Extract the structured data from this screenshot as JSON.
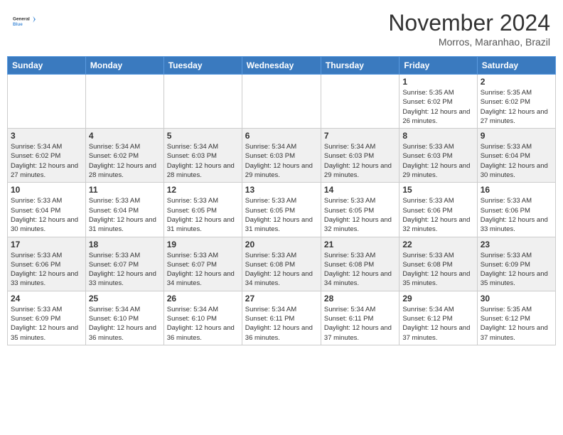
{
  "header": {
    "logo_line1": "General",
    "logo_line2": "Blue",
    "month": "November 2024",
    "location": "Morros, Maranhao, Brazil"
  },
  "weekdays": [
    "Sunday",
    "Monday",
    "Tuesday",
    "Wednesday",
    "Thursday",
    "Friday",
    "Saturday"
  ],
  "weeks": [
    [
      {
        "day": "",
        "info": ""
      },
      {
        "day": "",
        "info": ""
      },
      {
        "day": "",
        "info": ""
      },
      {
        "day": "",
        "info": ""
      },
      {
        "day": "",
        "info": ""
      },
      {
        "day": "1",
        "info": "Sunrise: 5:35 AM\nSunset: 6:02 PM\nDaylight: 12 hours and 26 minutes."
      },
      {
        "day": "2",
        "info": "Sunrise: 5:35 AM\nSunset: 6:02 PM\nDaylight: 12 hours and 27 minutes."
      }
    ],
    [
      {
        "day": "3",
        "info": "Sunrise: 5:34 AM\nSunset: 6:02 PM\nDaylight: 12 hours and 27 minutes."
      },
      {
        "day": "4",
        "info": "Sunrise: 5:34 AM\nSunset: 6:02 PM\nDaylight: 12 hours and 28 minutes."
      },
      {
        "day": "5",
        "info": "Sunrise: 5:34 AM\nSunset: 6:03 PM\nDaylight: 12 hours and 28 minutes."
      },
      {
        "day": "6",
        "info": "Sunrise: 5:34 AM\nSunset: 6:03 PM\nDaylight: 12 hours and 29 minutes."
      },
      {
        "day": "7",
        "info": "Sunrise: 5:34 AM\nSunset: 6:03 PM\nDaylight: 12 hours and 29 minutes."
      },
      {
        "day": "8",
        "info": "Sunrise: 5:33 AM\nSunset: 6:03 PM\nDaylight: 12 hours and 29 minutes."
      },
      {
        "day": "9",
        "info": "Sunrise: 5:33 AM\nSunset: 6:04 PM\nDaylight: 12 hours and 30 minutes."
      }
    ],
    [
      {
        "day": "10",
        "info": "Sunrise: 5:33 AM\nSunset: 6:04 PM\nDaylight: 12 hours and 30 minutes."
      },
      {
        "day": "11",
        "info": "Sunrise: 5:33 AM\nSunset: 6:04 PM\nDaylight: 12 hours and 31 minutes."
      },
      {
        "day": "12",
        "info": "Sunrise: 5:33 AM\nSunset: 6:05 PM\nDaylight: 12 hours and 31 minutes."
      },
      {
        "day": "13",
        "info": "Sunrise: 5:33 AM\nSunset: 6:05 PM\nDaylight: 12 hours and 31 minutes."
      },
      {
        "day": "14",
        "info": "Sunrise: 5:33 AM\nSunset: 6:05 PM\nDaylight: 12 hours and 32 minutes."
      },
      {
        "day": "15",
        "info": "Sunrise: 5:33 AM\nSunset: 6:06 PM\nDaylight: 12 hours and 32 minutes."
      },
      {
        "day": "16",
        "info": "Sunrise: 5:33 AM\nSunset: 6:06 PM\nDaylight: 12 hours and 33 minutes."
      }
    ],
    [
      {
        "day": "17",
        "info": "Sunrise: 5:33 AM\nSunset: 6:06 PM\nDaylight: 12 hours and 33 minutes."
      },
      {
        "day": "18",
        "info": "Sunrise: 5:33 AM\nSunset: 6:07 PM\nDaylight: 12 hours and 33 minutes."
      },
      {
        "day": "19",
        "info": "Sunrise: 5:33 AM\nSunset: 6:07 PM\nDaylight: 12 hours and 34 minutes."
      },
      {
        "day": "20",
        "info": "Sunrise: 5:33 AM\nSunset: 6:08 PM\nDaylight: 12 hours and 34 minutes."
      },
      {
        "day": "21",
        "info": "Sunrise: 5:33 AM\nSunset: 6:08 PM\nDaylight: 12 hours and 34 minutes."
      },
      {
        "day": "22",
        "info": "Sunrise: 5:33 AM\nSunset: 6:08 PM\nDaylight: 12 hours and 35 minutes."
      },
      {
        "day": "23",
        "info": "Sunrise: 5:33 AM\nSunset: 6:09 PM\nDaylight: 12 hours and 35 minutes."
      }
    ],
    [
      {
        "day": "24",
        "info": "Sunrise: 5:33 AM\nSunset: 6:09 PM\nDaylight: 12 hours and 35 minutes."
      },
      {
        "day": "25",
        "info": "Sunrise: 5:34 AM\nSunset: 6:10 PM\nDaylight: 12 hours and 36 minutes."
      },
      {
        "day": "26",
        "info": "Sunrise: 5:34 AM\nSunset: 6:10 PM\nDaylight: 12 hours and 36 minutes."
      },
      {
        "day": "27",
        "info": "Sunrise: 5:34 AM\nSunset: 6:11 PM\nDaylight: 12 hours and 36 minutes."
      },
      {
        "day": "28",
        "info": "Sunrise: 5:34 AM\nSunset: 6:11 PM\nDaylight: 12 hours and 37 minutes."
      },
      {
        "day": "29",
        "info": "Sunrise: 5:34 AM\nSunset: 6:12 PM\nDaylight: 12 hours and 37 minutes."
      },
      {
        "day": "30",
        "info": "Sunrise: 5:35 AM\nSunset: 6:12 PM\nDaylight: 12 hours and 37 minutes."
      }
    ]
  ]
}
